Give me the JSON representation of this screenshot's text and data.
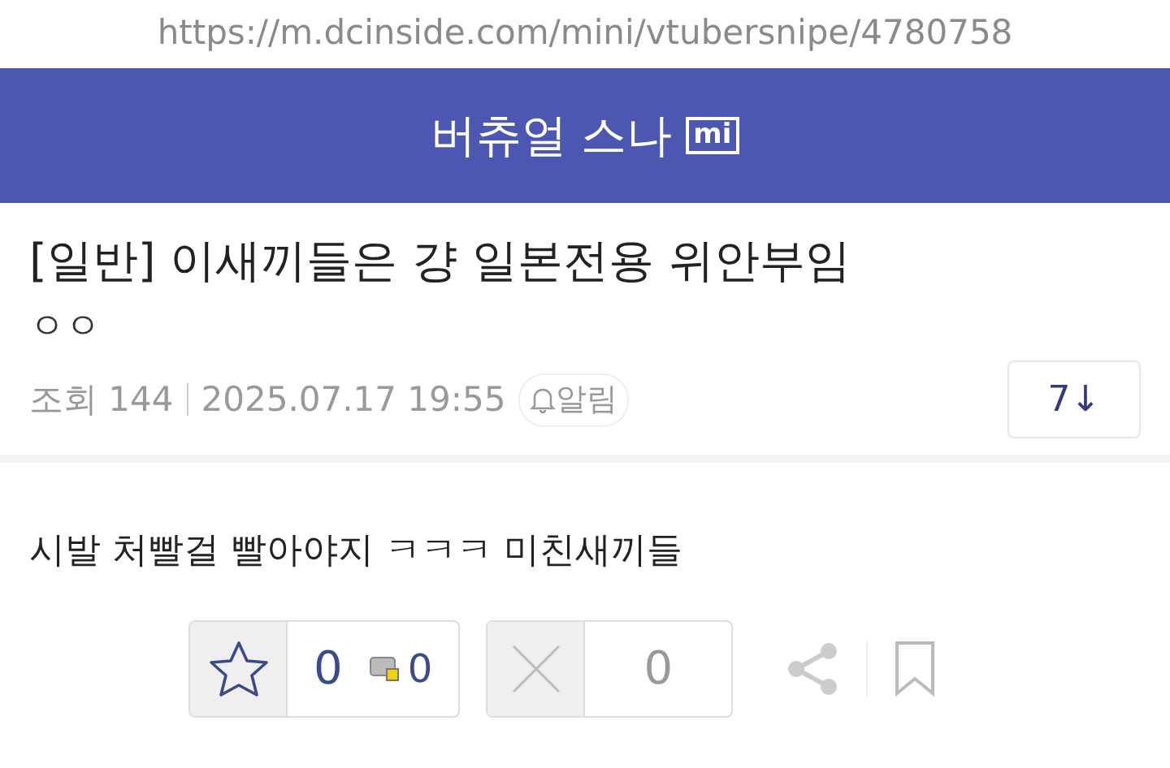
{
  "url_bar": {
    "url": "https://m.dcinside.com/mini/vtubersnipe/4780758"
  },
  "header": {
    "title": "버츄얼 스나",
    "badge": "mi"
  },
  "post": {
    "title": "[일반] 이새끼들은 걍 일본전용 위안부임",
    "author": "ㅇㅇ",
    "views": "조회 144",
    "date": "2025.07.17 19:55",
    "alarm": "알림",
    "comment_count": "7↓"
  },
  "body": "시발 처빨걸 빨아야지 ㅋㅋㅋ 미친새끼들",
  "actions": {
    "recommend": "0",
    "fixed_recommend": "0",
    "dislike": "0"
  }
}
